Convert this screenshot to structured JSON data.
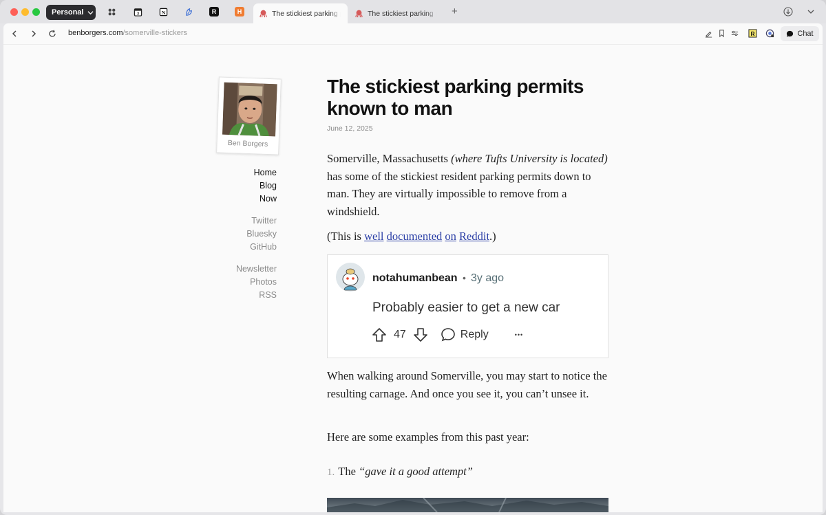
{
  "browser": {
    "profile": "Personal",
    "tabs": [
      {
        "title": "The stickiest parking permits known to man",
        "active": true
      },
      {
        "title": "The stickiest parking permits known to man",
        "active": false
      }
    ],
    "pinned_icons": [
      "grid-icon",
      "calendar-icon",
      "notion-icon",
      "bird-icon",
      "readwise-icon",
      "hacker-news-icon"
    ],
    "url_domain": "benborgers.com",
    "url_path": "/somerville-stickers",
    "chat_label": "Chat"
  },
  "sidebar": {
    "author": "Ben Borgers",
    "primary_links": [
      "Home",
      "Blog",
      "Now"
    ],
    "social_links": [
      "Twitter",
      "Bluesky",
      "GitHub"
    ],
    "other_links": [
      "Newsletter",
      "Photos",
      "RSS"
    ]
  },
  "article": {
    "title": "The stickiest parking permits known to man",
    "date": "June 12, 2025",
    "p1_a": "Somerville, Massachusetts ",
    "p1_em": "(where Tufts University is located)",
    "p1_b": " has some of the stickiest resident parking permits down to man. They are virtually impossible to remove from a windshield.",
    "p2_open": "(This is ",
    "p2_links": [
      "well",
      "documented",
      "on",
      "Reddit"
    ],
    "p2_close": ".)",
    "p3": "When walking around Somerville, you may start to notice the resulting carnage. And once you see it, you can’t unsee it.",
    "p4": "Here are some examples from this past year:",
    "list": [
      {
        "num": "1.",
        "text_a": "The ",
        "text_em": "“gave it a good attempt”"
      }
    ]
  },
  "reddit_comment": {
    "username": "notahumanbean",
    "separator": "•",
    "time": "3y ago",
    "body": "Probably easier to get a new car",
    "votes": "47",
    "reply": "Reply",
    "more": "•••"
  },
  "colors": {
    "link": "#2b3fa6",
    "page_bg": "#fafafa",
    "profile_bg": "#2b2b2e"
  }
}
